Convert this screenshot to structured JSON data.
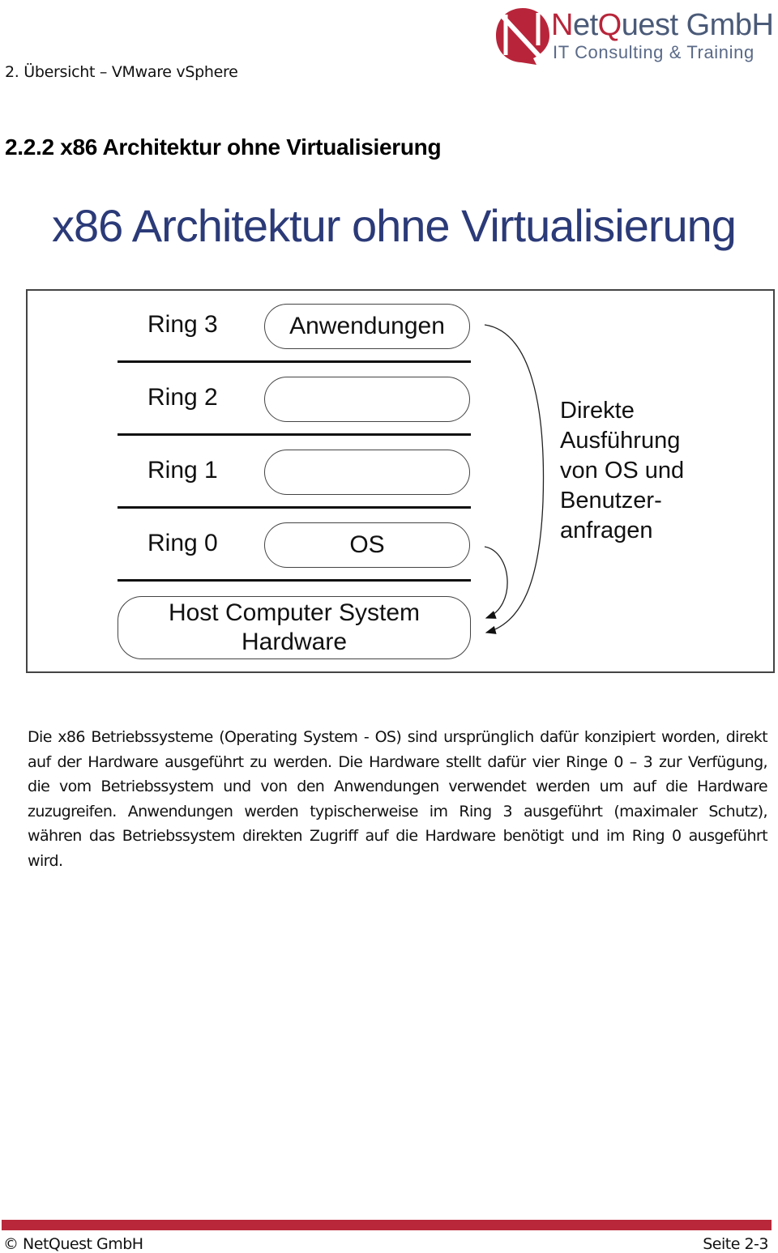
{
  "header": {
    "chapter": "2. Übersicht – VMware vSphere",
    "logo": {
      "name_first": "N",
      "name_mid": "et",
      "name_q": "Q",
      "name_rest": "uest GmbH",
      "tagline": "IT Consulting & Training",
      "brand_color": "#b8253a",
      "text_color": "#4a5a78"
    }
  },
  "section": {
    "title": "2.2.2 x86 Architektur ohne Virtualisierung"
  },
  "slide": {
    "title": "x86 Architektur ohne Virtualisierung",
    "title_color": "#2b3a78",
    "rings": [
      {
        "label": "Ring 3",
        "content": "Anwendungen"
      },
      {
        "label": "Ring 2",
        "content": ""
      },
      {
        "label": "Ring 1",
        "content": ""
      },
      {
        "label": "Ring 0",
        "content": "OS"
      }
    ],
    "hardware": {
      "line1": "Host Computer System",
      "line2": "Hardware"
    },
    "note": "Direkte\nAusführung\nvon OS und\nBenutzer-\nanfragen"
  },
  "body": {
    "paragraph": "Die x86 Betriebssysteme (Operating System - OS) sind ursprünglich dafür konzipiert worden, direkt auf der Hardware ausgeführt zu werden. Die Hardware stellt dafür vier Ringe 0 – 3 zur Verfügung, die vom Betriebssystem und von den Anwendungen verwendet werden um auf die Hardware zuzugreifen. Anwendungen werden typischerweise im Ring 3 ausgeführt (maximaler Schutz), währen das Betriebssystem direkten Zugriff auf die Hardware benötigt und im Ring 0 ausgeführt wird."
  },
  "footer": {
    "copyright": "© NetQuest GmbH",
    "page": "Seite 2-3",
    "bar_color": "#b8283a"
  }
}
